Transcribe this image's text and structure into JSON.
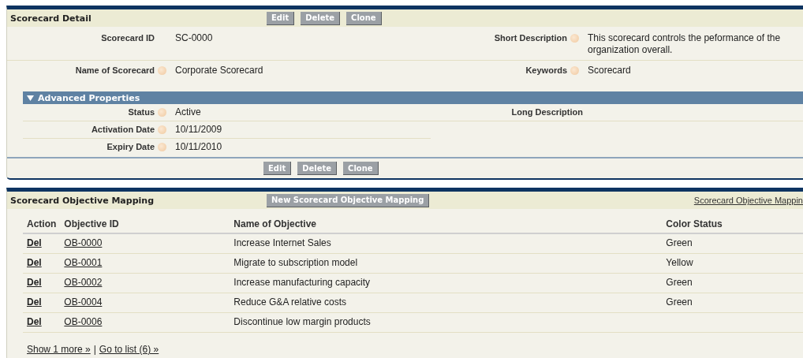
{
  "detail": {
    "title": "Scorecard Detail",
    "buttons": [
      "Edit",
      "Delete",
      "Clone"
    ],
    "fields": [
      {
        "left": {
          "label": "Scorecard ID",
          "help_icon": false,
          "value": "SC-0000"
        },
        "right": {
          "label": "Short Description",
          "help_icon": true,
          "value": "This scorecard controls the peformance of the organization overall."
        }
      },
      {
        "left": {
          "label": "Name of Scorecard",
          "help_icon": true,
          "value": "Corporate Scorecard"
        },
        "right": {
          "label": "Keywords",
          "help_icon": true,
          "value": "Scorecard"
        }
      }
    ],
    "section": {
      "title": "Advanced Properties",
      "expanded": true,
      "fields": [
        {
          "left": {
            "label": "Status",
            "help_icon": true,
            "value": "Active"
          },
          "right": {
            "label": "Long Description",
            "help_icon": false
          }
        },
        {
          "left": {
            "label": "Activation Date",
            "help_icon": true,
            "value": "10/11/2009"
          }
        },
        {
          "left": {
            "label": "Expiry Date",
            "help_icon": true,
            "value": "10/11/2010"
          }
        }
      ]
    },
    "footer_buttons": [
      "Edit",
      "Delete",
      "Clone"
    ]
  },
  "related": {
    "title": "Scorecard Objective Mapping",
    "new_button": "New Scorecard Objective Mapping",
    "help_link": "Scorecard Objective Mappin",
    "table": {
      "columns": [
        "Action",
        "Objective ID",
        "Name of Objective",
        "Color Status"
      ],
      "rows": [
        {
          "action": "Del",
          "id": "OB-0000",
          "name": "Increase Internet Sales",
          "color_status": "Green"
        },
        {
          "action": "Del",
          "id": "OB-0001",
          "name": "Migrate to subscription model",
          "color_status": "Yellow"
        },
        {
          "action": "Del",
          "id": "OB-0002",
          "name": "Increase manufacturing capacity",
          "color_status": "Green"
        },
        {
          "action": "Del",
          "id": "OB-0004",
          "name": "Reduce G&A relative costs",
          "color_status": "Green"
        },
        {
          "action": "Del",
          "id": "OB-0006",
          "name": "Discontinue low margin products"
        }
      ]
    },
    "footer_links": [
      "Show 1 more »",
      "Go to list (6) »"
    ],
    "separator": "|"
  }
}
